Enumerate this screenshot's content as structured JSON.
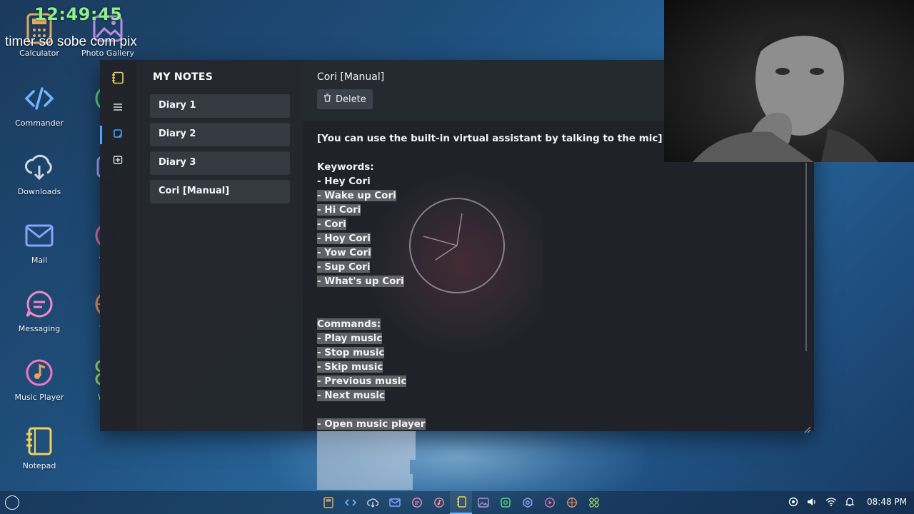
{
  "overlay": {
    "timer": "12:49:45",
    "caption": "timer só sobe com pix"
  },
  "desktop": {
    "icons": [
      {
        "label": "Calculator",
        "icon": "calculator-icon"
      },
      {
        "label": "Photo Gallery",
        "icon": "photo-gallery-icon"
      },
      {
        "label": "Commander",
        "icon": "code-icon"
      },
      {
        "label": "Re",
        "icon": "recorder-icon"
      },
      {
        "label": "Downloads",
        "icon": "download-cloud-icon"
      },
      {
        "label": "Se",
        "icon": "settings-icon"
      },
      {
        "label": "Mail",
        "icon": "mail-icon"
      },
      {
        "label": "Vide",
        "icon": "video-icon"
      },
      {
        "label": "Messaging",
        "icon": "chat-icon"
      },
      {
        "label": "Web",
        "icon": "globe-icon"
      },
      {
        "label": "Music Player",
        "icon": "music-icon"
      },
      {
        "label": "Widg",
        "icon": "widgets-icon"
      },
      {
        "label": "Notepad",
        "icon": "notepad-icon"
      }
    ]
  },
  "notepad": {
    "panel_title": "MY NOTES",
    "notes": [
      "Diary 1",
      "Diary 2",
      "Diary 3",
      "Cori [Manual]"
    ],
    "current_note_title": "Cori [Manual]",
    "delete_label": "Delete",
    "lines": [
      {
        "text": "[You can use the built-in virtual assistant by talking to the mic]",
        "hl": false
      },
      {
        "text": "",
        "hl": false
      },
      {
        "text": "Keywords:",
        "hl": false
      },
      {
        "text": "- Hey Cori",
        "hl": false
      },
      {
        "text": "- Wake up Cori",
        "hl": true
      },
      {
        "text": "- Hi Cori",
        "hl": true
      },
      {
        "text": "- Cori",
        "hl": true
      },
      {
        "text": "- Hoy Cori",
        "hl": true
      },
      {
        "text": "- Yow Cori",
        "hl": true
      },
      {
        "text": "- Sup Cori",
        "hl": true
      },
      {
        "text": "- What's up Cori",
        "hl": true
      },
      {
        "text": "",
        "hl": false
      },
      {
        "text": "",
        "hl": false
      },
      {
        "text": "Commands:",
        "hl": true
      },
      {
        "text": "- Play music",
        "hl": true
      },
      {
        "text": "- Stop music",
        "hl": true
      },
      {
        "text": "- Skip music",
        "hl": true
      },
      {
        "text": "- Previous music",
        "hl": true
      },
      {
        "text": "- Next music",
        "hl": true
      },
      {
        "text": "",
        "hl": false
      },
      {
        "text": "- Open music player",
        "hl": true
      }
    ]
  },
  "taskbar": {
    "apps": [
      "calculator-icon",
      "code-icon",
      "download-cloud-icon",
      "mail-icon",
      "chat-icon",
      "music-icon",
      "notepad-icon",
      "photo-gallery-icon",
      "recorder-icon",
      "settings-icon",
      "video-icon",
      "globe-icon",
      "widgets-icon"
    ],
    "active_app": "notepad-icon",
    "time": "08:48 PM"
  },
  "colors": {
    "accent": "#4da3ff",
    "timer": "#8ef08a"
  }
}
